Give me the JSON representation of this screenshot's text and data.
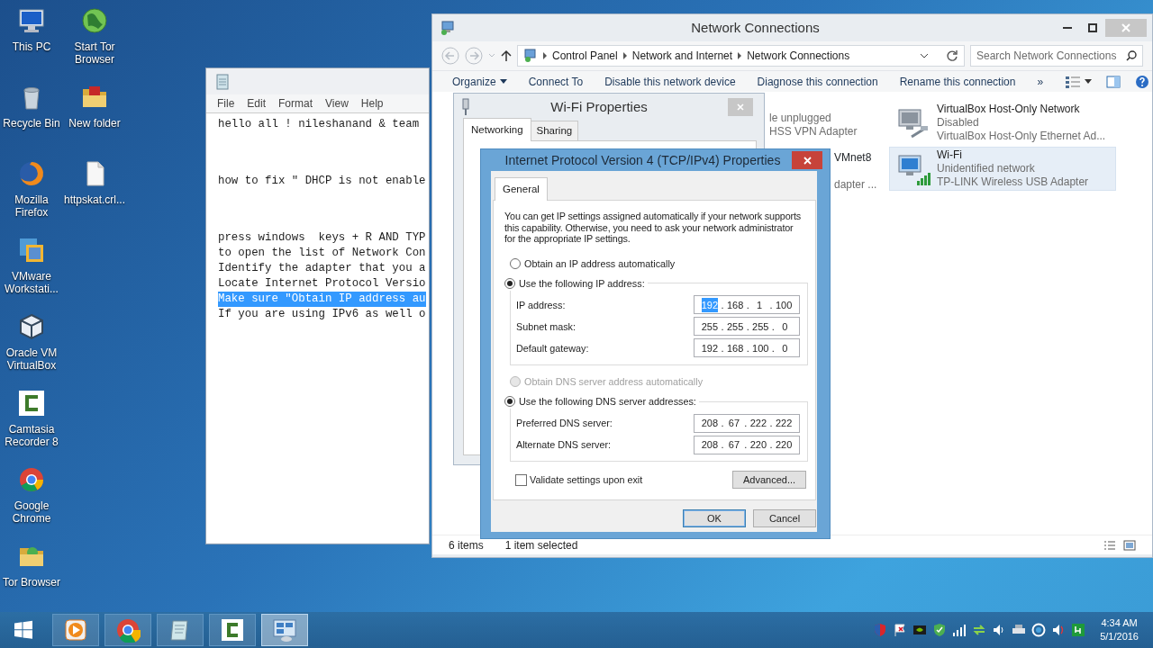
{
  "desktop": {
    "icon_columns": [
      [
        {
          "label": "This PC"
        },
        {
          "label": "Recycle Bin"
        },
        {
          "label": "Mozilla Firefox"
        },
        {
          "label": "VMware Workstati..."
        },
        {
          "label": "Oracle VM VirtualBox"
        },
        {
          "label": "Camtasia Recorder 8"
        },
        {
          "label": "Google Chrome"
        },
        {
          "label": "Tor Browser"
        }
      ],
      [
        {
          "label": "Start Tor Browser"
        },
        {
          "label": "New folder"
        },
        {
          "label": "httpskat.crl..."
        }
      ]
    ]
  },
  "notepad": {
    "menu": [
      "File",
      "Edit",
      "Format",
      "View",
      "Help"
    ],
    "paragraphs": [
      [
        {
          "text": "hello all ! nileshanand & team",
          "selected": false
        }
      ],
      [
        {
          "text": "how to fix \" DHCP is not enable",
          "selected": false
        }
      ],
      [
        {
          "text": "press windows  keys + R AND TYP",
          "selected": false
        },
        {
          "text": "to open the list of Network Con",
          "selected": false
        },
        {
          "text": "Identify the adapter that you a",
          "selected": false
        },
        {
          "text": "Locate Internet Protocol Versio",
          "selected": false
        },
        {
          "text": "Make sure \"Obtain IP address au",
          "selected": true
        },
        {
          "text": "If you are using IPv6 as well o",
          "selected": false
        }
      ]
    ]
  },
  "network_connections": {
    "title": "Network Connections",
    "breadcrumb": [
      "Control Panel",
      "Network and Internet",
      "Network Connections"
    ],
    "search_placeholder": "Search Network Connections",
    "toolbar": [
      "Organize",
      "Connect To",
      "Disable this network device",
      "Diagnose this connection",
      "Rename this connection"
    ],
    "more": "»",
    "partial_items": [
      {
        "lines": [
          "le unplugged",
          "HSS VPN Adapter"
        ]
      },
      {
        "lines": [
          "VMnet8",
          "dapter ..."
        ]
      }
    ],
    "items": [
      {
        "name": "VirtualBox Host-Only Network",
        "status": "Disabled",
        "adapter": "VirtualBox Host-Only Ethernet Ad...",
        "selected": false,
        "disabled": true
      },
      {
        "name": "Wi-Fi",
        "status": "Unidentified network",
        "adapter": "TP-LINK Wireless USB Adapter",
        "selected": true,
        "disabled": false
      }
    ],
    "status_bar": {
      "count": "6 items",
      "selection": "1 item selected"
    }
  },
  "wifi_properties": {
    "title": "Wi-Fi Properties",
    "tabs": [
      {
        "label": "Networking",
        "selected": true
      },
      {
        "label": "Sharing",
        "selected": false
      }
    ]
  },
  "ipv4_properties": {
    "title": "Internet Protocol Version 4 (TCP/IPv4) Properties",
    "tabs": [
      {
        "label": "General",
        "selected": true
      }
    ],
    "intro": "You can get IP settings assigned automatically if your network supports this capability. Otherwise, you need to ask your network administrator for the appropriate IP settings.",
    "separator": ".",
    "ip_modes": [
      {
        "label": "Obtain an IP address automatically",
        "selected": false,
        "disabled": false
      },
      {
        "label": "Use the following IP address:",
        "selected": true,
        "disabled": false
      }
    ],
    "ip_fields": [
      {
        "label": "IP address:",
        "octets": [
          {
            "text": "192",
            "selected": true
          },
          {
            "text": "168",
            "selected": false
          },
          {
            "text": "1",
            "selected": false
          },
          {
            "text": "100",
            "selected": false
          }
        ]
      },
      {
        "label": "Subnet mask:",
        "octets": [
          {
            "text": "255",
            "selected": false
          },
          {
            "text": "255",
            "selected": false
          },
          {
            "text": "255",
            "selected": false
          },
          {
            "text": "0",
            "selected": false
          }
        ]
      },
      {
        "label": "Default gateway:",
        "octets": [
          {
            "text": "192",
            "selected": false
          },
          {
            "text": "168",
            "selected": false
          },
          {
            "text": "100",
            "selected": false
          },
          {
            "text": "0",
            "selected": false
          }
        ]
      }
    ],
    "dns_modes": [
      {
        "label": "Obtain DNS server address automatically",
        "selected": false,
        "disabled": true
      },
      {
        "label": "Use the following DNS server addresses:",
        "selected": true,
        "disabled": false
      }
    ],
    "dns_fields": [
      {
        "label": "Preferred DNS server:",
        "octets": [
          {
            "text": "208",
            "selected": false
          },
          {
            "text": "67",
            "selected": false
          },
          {
            "text": "222",
            "selected": false
          },
          {
            "text": "222",
            "selected": false
          }
        ]
      },
      {
        "label": "Alternate DNS server:",
        "octets": [
          {
            "text": "208",
            "selected": false
          },
          {
            "text": "67",
            "selected": false
          },
          {
            "text": "220",
            "selected": false
          },
          {
            "text": "220",
            "selected": false
          }
        ]
      }
    ],
    "validate": {
      "label": "Validate settings upon exit",
      "checked": false
    },
    "advanced": "Advanced...",
    "ok": "OK",
    "cancel": "Cancel"
  },
  "taskbar": {
    "apps": [
      {
        "selected": false
      },
      {
        "selected": false
      },
      {
        "selected": false
      },
      {
        "selected": false
      },
      {
        "selected": true
      }
    ],
    "time": "4:34 AM",
    "date": "5/1/2016"
  }
}
